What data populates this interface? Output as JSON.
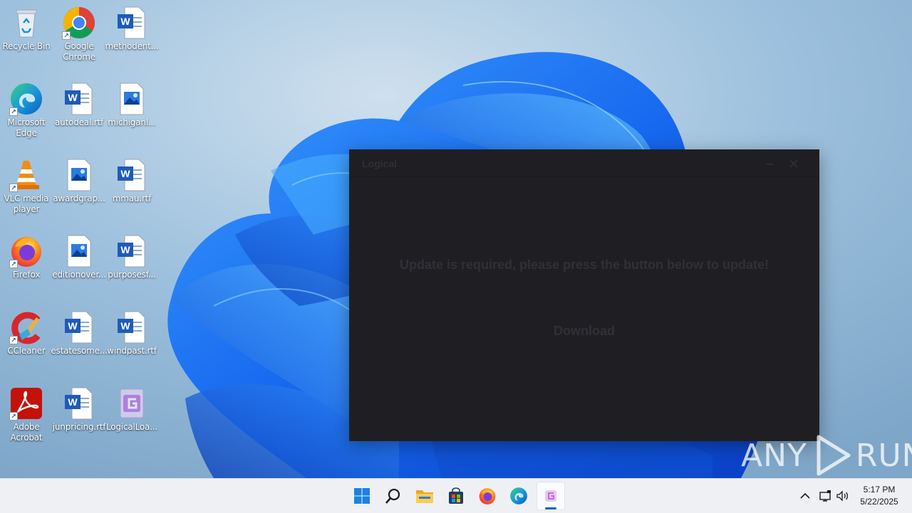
{
  "desktop": {
    "icons": [
      {
        "label": "Recycle Bin",
        "icon": "recycle-bin-icon"
      },
      {
        "label": "Google Chrome",
        "icon": "chrome-icon"
      },
      {
        "label": "methodent...",
        "icon": "word-doc-icon"
      },
      {
        "label": "Microsoft Edge",
        "icon": "edge-icon"
      },
      {
        "label": "autodeal.rtf",
        "icon": "word-doc-icon"
      },
      {
        "label": "michiganl...",
        "icon": "image-file-icon"
      },
      {
        "label": "VLC media player",
        "icon": "vlc-icon"
      },
      {
        "label": "awardgrap...",
        "icon": "image-file-icon"
      },
      {
        "label": "mmau.rtf",
        "icon": "word-doc-icon"
      },
      {
        "label": "Firefox",
        "icon": "firefox-icon"
      },
      {
        "label": "editionover...",
        "icon": "image-file-icon"
      },
      {
        "label": "purposesf...",
        "icon": "word-doc-icon"
      },
      {
        "label": "CCleaner",
        "icon": "ccleaner-icon"
      },
      {
        "label": "estatesome...",
        "icon": "word-doc-icon"
      },
      {
        "label": "windpast.rtf",
        "icon": "word-doc-icon"
      },
      {
        "label": "Adobe Acrobat",
        "icon": "acrobat-icon"
      },
      {
        "label": "junpricing.rtf",
        "icon": "word-doc-icon"
      },
      {
        "label": "LogicalLoa...",
        "icon": "logical-loader-icon"
      }
    ]
  },
  "app_window": {
    "title": "Logical",
    "message": "Update is required, please press the button below to update!",
    "download_label": "Download"
  },
  "watermark": {
    "text_left": "ANY",
    "text_right": "RUN"
  },
  "taskbar": {
    "items": [
      "start-icon",
      "search-icon",
      "file-explorer-icon",
      "store-icon",
      "firefox-icon",
      "edge-icon",
      "logical-app-icon"
    ],
    "clock_time": "5:17 PM",
    "clock_date": "5/22/2025"
  },
  "colors": {
    "window_bg": "#1f1f23",
    "window_text": "#303036",
    "taskbar_bg": "#eef0f4",
    "wallpaper_blue": "#1a6cf0"
  }
}
